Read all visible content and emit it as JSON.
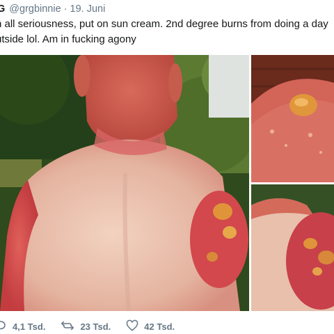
{
  "tweet": {
    "author_initial": "G",
    "handle": "@grgbinnie",
    "separator": "·",
    "date": "19. Juni",
    "text_line1": "n all seriousness, put on sun cream. 2nd degree burns from doing a day",
    "text_line2": "utside lol. Am in fucking agony"
  },
  "media": {
    "photos": [
      {
        "description_icon": "image-icon"
      },
      {
        "description_icon": "image-icon"
      },
      {
        "description_icon": "image-icon"
      }
    ]
  },
  "actions": {
    "reply_count": "4,1 Tsd.",
    "retweet_count": "23 Tsd.",
    "like_count": "42 Tsd.",
    "icons": [
      "reply-icon",
      "retweet-icon",
      "heart-icon"
    ]
  },
  "colors": {
    "text": "#14171a",
    "secondary": "#657786",
    "skin": "#e8b8a0",
    "sunburn": "#d04848",
    "foliage": "#3f5a22"
  }
}
